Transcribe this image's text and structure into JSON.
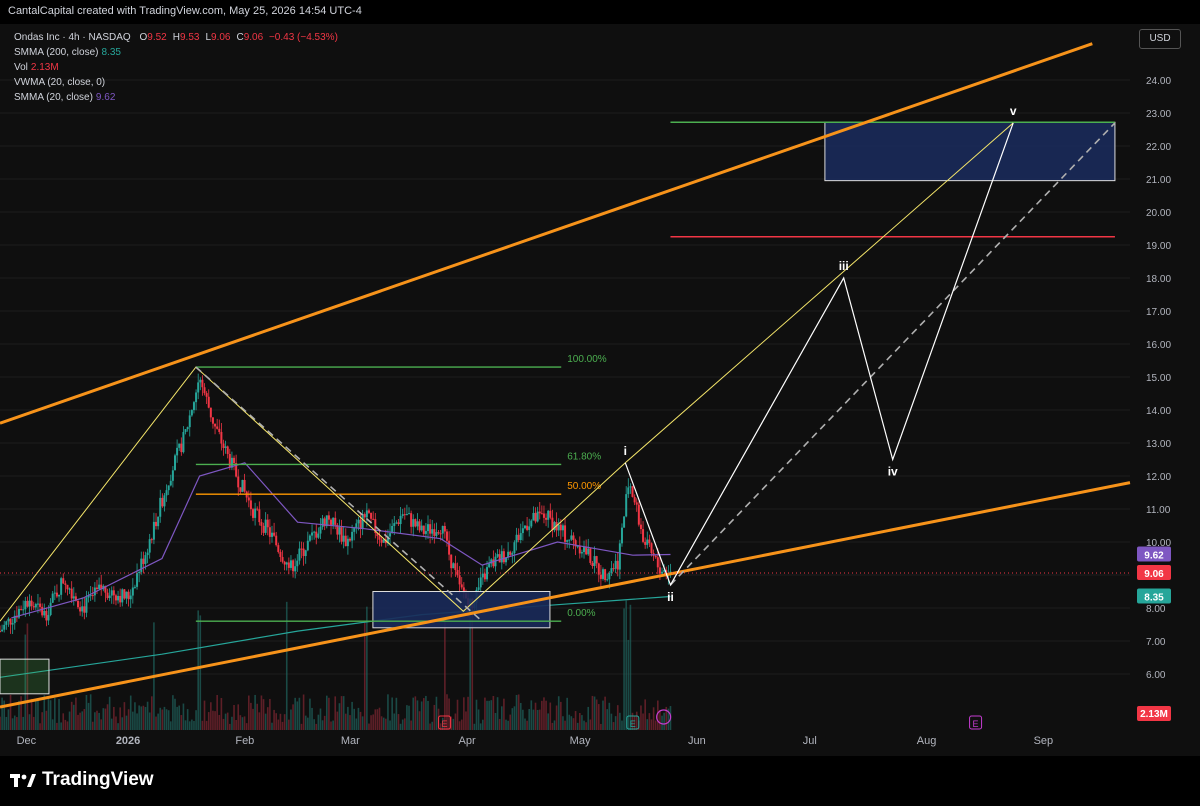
{
  "header": {
    "attribution": "CantalCapital created with TradingView.com, May 25, 2026 14:54 UTC-4"
  },
  "legend": {
    "symbol": "Ondas Inc · 4h · NASDAQ",
    "ohlc": [
      {
        "k": "O",
        "v": "9.52"
      },
      {
        "k": "H",
        "v": "9.53"
      },
      {
        "k": "L",
        "v": "9.06"
      },
      {
        "k": "C",
        "v": "9.06"
      }
    ],
    "change": "−0.43 (−4.53%)",
    "indicators": [
      {
        "label": "SMMA (200, close)",
        "value": "8.35",
        "color": "#26a69a"
      },
      {
        "label": "Vol",
        "value": "2.13M",
        "color": "#f23645"
      },
      {
        "label": "VWMA (20, close, 0)",
        "value": "",
        "color": "#d1d4dc"
      },
      {
        "label": "SMMA (20, close)",
        "value": "9.62",
        "color": "#7e57c2"
      }
    ]
  },
  "currency_button": "USD",
  "footer": {
    "brand": "TradingView"
  },
  "colors": {
    "up": "#26a69a",
    "down": "#f23645",
    "channel": "#f7931a",
    "fib_green": "#4caf50",
    "fib_orange": "#ff9800",
    "resistance": "#f23645",
    "target_box": "#1a2a5a",
    "sma200": "#26a69a",
    "sma20": "#7e57c2"
  },
  "chart_data": {
    "type": "candlestick",
    "title": "Ondas Inc · 4h · NASDAQ",
    "ylim": [
      5.0,
      25.0
    ],
    "y_ticks": [
      6.0,
      7.0,
      8.0,
      9.0,
      10.0,
      11.0,
      12.0,
      13.0,
      14.0,
      15.0,
      16.0,
      17.0,
      18.0,
      19.0,
      20.0,
      21.0,
      22.0,
      23.0,
      24.0
    ],
    "x_labels": [
      "Dec",
      "2026",
      "Feb",
      "Mar",
      "Apr",
      "May",
      "Jun",
      "Jul",
      "Aug",
      "Sep"
    ],
    "x_domain": [
      "2025-11-28",
      "2026-09-24"
    ],
    "price_labels": [
      {
        "value": 9.62,
        "text": "9.62",
        "color": "#7e57c2"
      },
      {
        "value": 9.06,
        "text": "9.06",
        "color": "#f23645"
      },
      {
        "value": 8.35,
        "text": "8.35",
        "color": "#26a69a"
      }
    ],
    "volume_label": "2.13M",
    "price_path": [
      [
        "2025-11-28",
        7.3
      ],
      [
        "2025-12-05",
        8.2
      ],
      [
        "2025-12-10",
        7.8
      ],
      [
        "2025-12-15",
        8.9
      ],
      [
        "2025-12-20",
        8.0
      ],
      [
        "2025-12-25",
        8.6
      ],
      [
        "2026-01-01",
        8.3
      ],
      [
        "2026-01-06",
        9.8
      ],
      [
        "2026-01-12",
        12.0
      ],
      [
        "2026-01-16",
        13.2
      ],
      [
        "2026-01-20",
        15.0
      ],
      [
        "2026-01-24",
        13.5
      ],
      [
        "2026-01-29",
        12.2
      ],
      [
        "2026-02-03",
        11.0
      ],
      [
        "2026-02-08",
        10.2
      ],
      [
        "2026-02-13",
        9.2
      ],
      [
        "2026-02-18",
        10.0
      ],
      [
        "2026-02-23",
        10.8
      ],
      [
        "2026-02-28",
        10.0
      ],
      [
        "2026-03-05",
        10.8
      ],
      [
        "2026-03-10",
        10.0
      ],
      [
        "2026-03-15",
        10.9
      ],
      [
        "2026-03-20",
        10.3
      ],
      [
        "2026-03-25",
        10.5
      ],
      [
        "2026-03-30",
        8.6
      ],
      [
        "2026-04-02",
        8.1
      ],
      [
        "2026-04-07",
        9.3
      ],
      [
        "2026-04-12",
        9.7
      ],
      [
        "2026-04-17",
        10.6
      ],
      [
        "2026-04-22",
        10.8
      ],
      [
        "2026-04-27",
        10.2
      ],
      [
        "2026-05-02",
        9.8
      ],
      [
        "2026-05-07",
        9.0
      ],
      [
        "2026-05-11",
        9.4
      ],
      [
        "2026-05-14",
        11.9
      ],
      [
        "2026-05-18",
        10.0
      ],
      [
        "2026-05-22",
        9.2
      ],
      [
        "2026-05-25",
        9.06
      ]
    ],
    "volume_spikes": [
      "2025-12-05",
      "2026-01-08",
      "2026-01-20",
      "2026-02-12",
      "2026-03-05",
      "2026-03-26",
      "2026-04-02",
      "2026-05-13",
      "2026-05-14"
    ],
    "sma200": [
      [
        "2025-11-28",
        5.9
      ],
      [
        "2026-01-10",
        6.6
      ],
      [
        "2026-02-15",
        7.3
      ],
      [
        "2026-03-20",
        7.8
      ],
      [
        "2026-04-25",
        8.1
      ],
      [
        "2026-05-25",
        8.35
      ]
    ],
    "sma20": [
      [
        "2025-12-01",
        7.7
      ],
      [
        "2025-12-20",
        8.3
      ],
      [
        "2026-01-10",
        9.5
      ],
      [
        "2026-01-20",
        12.0
      ],
      [
        "2026-02-01",
        12.4
      ],
      [
        "2026-02-15",
        10.6
      ],
      [
        "2026-03-05",
        10.4
      ],
      [
        "2026-03-25",
        10.1
      ],
      [
        "2026-04-05",
        9.3
      ],
      [
        "2026-04-25",
        10.0
      ],
      [
        "2026-05-15",
        9.6
      ],
      [
        "2026-05-25",
        9.62
      ]
    ],
    "channel_upper": [
      [
        "2025-11-28",
        13.6
      ],
      [
        "2026-09-14",
        25.1
      ]
    ],
    "channel_lower": [
      [
        "2025-11-28",
        5.0
      ],
      [
        "2026-09-24",
        11.8
      ]
    ],
    "fib_levels": [
      {
        "label": "100.00%",
        "value": 15.3,
        "color": "#4caf50"
      },
      {
        "label": "61.80%",
        "value": 12.35,
        "color": "#4caf50"
      },
      {
        "label": "50.00%",
        "value": 11.45,
        "color": "#ff9800"
      },
      {
        "label": "0.00%",
        "value": 7.6,
        "color": "#4caf50"
      }
    ],
    "fib_range": [
      "2026-01-19",
      "2026-04-26"
    ],
    "resistance_line": {
      "value": 19.25,
      "from": "2026-05-25",
      "to": "2026-09-20"
    },
    "target_top_line": {
      "value": 22.72,
      "from": "2026-05-25",
      "to": "2026-09-20"
    },
    "target_box": {
      "from": "2026-07-05",
      "to": "2026-09-20",
      "low": 20.95,
      "high": 22.72
    },
    "buy_zone_box": {
      "from": "2026-03-07",
      "to": "2026-04-23",
      "low": 7.4,
      "high": 8.5
    },
    "left_box": {
      "from": "2025-11-28",
      "to": "2025-12-11",
      "low": 5.4,
      "high": 6.45
    },
    "wave_path": [
      [
        "2026-05-13",
        12.4
      ],
      [
        "2026-05-25",
        8.7
      ],
      [
        "2026-07-10",
        18.0
      ],
      [
        "2026-07-23",
        12.5
      ],
      [
        "2026-08-24",
        22.7
      ]
    ],
    "wave_labels": [
      {
        "text": "i",
        "date": "2026-05-13",
        "value": 12.4,
        "pos": "above"
      },
      {
        "text": "ii",
        "date": "2026-05-25",
        "value": 8.7,
        "pos": "below"
      },
      {
        "text": "iii",
        "date": "2026-07-10",
        "value": 18.0,
        "pos": "above"
      },
      {
        "text": "iv",
        "date": "2026-07-23",
        "value": 12.5,
        "pos": "below"
      },
      {
        "text": "v",
        "date": "2026-08-24",
        "value": 22.7,
        "pos": "above"
      }
    ],
    "yellow_lines": [
      [
        [
          "2025-11-28",
          7.6
        ],
        [
          "2026-01-19",
          15.3
        ],
        [
          "2026-03-31",
          7.9
        ],
        [
          "2026-05-13",
          12.4
        ]
      ],
      [
        [
          "2026-05-13",
          12.4
        ],
        [
          "2026-08-24",
          22.7
        ]
      ]
    ],
    "dashed_lines": [
      [
        [
          "2026-01-19",
          15.3
        ],
        [
          "2026-04-05",
          7.6
        ]
      ],
      [
        [
          "2026-05-25",
          8.7
        ],
        [
          "2026-09-20",
          22.7
        ]
      ]
    ]
  }
}
